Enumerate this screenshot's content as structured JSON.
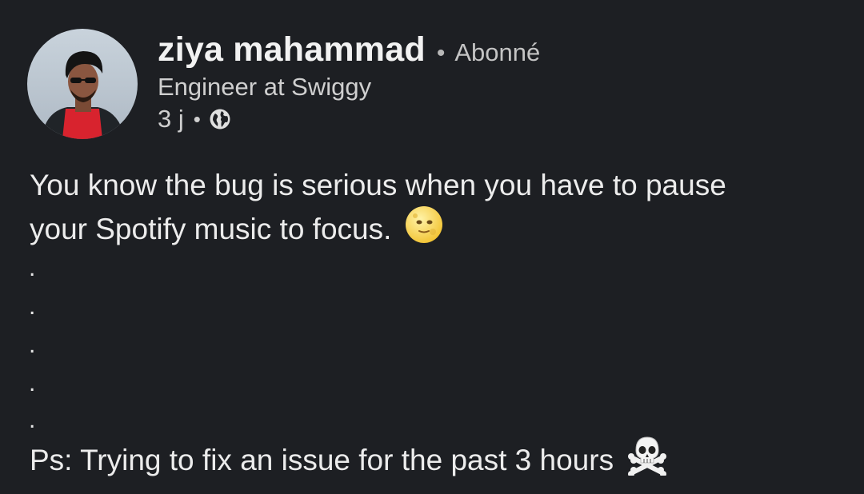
{
  "author": {
    "name": "ziya mahammad",
    "follow_status": "Abonné",
    "headline": "Engineer at Swiggy",
    "time": "3 j",
    "separator": "•",
    "visibility_icon": "globe-icon",
    "avatar_icon": "avatar-photo"
  },
  "post": {
    "line1": "You know the bug is serious when you have to pause",
    "line2": "your Spotify music to focus.",
    "line2_emoji": "moon-face-icon",
    "dots": [
      ".",
      ".",
      ".",
      ".",
      "."
    ],
    "ps": "Ps: Trying to fix an issue for the past 3 hours",
    "ps_emoji": "skull-crossbones-icon"
  },
  "colors": {
    "background": "#1d1f23",
    "text": "#ececec",
    "secondary": "#c4c4c4"
  }
}
